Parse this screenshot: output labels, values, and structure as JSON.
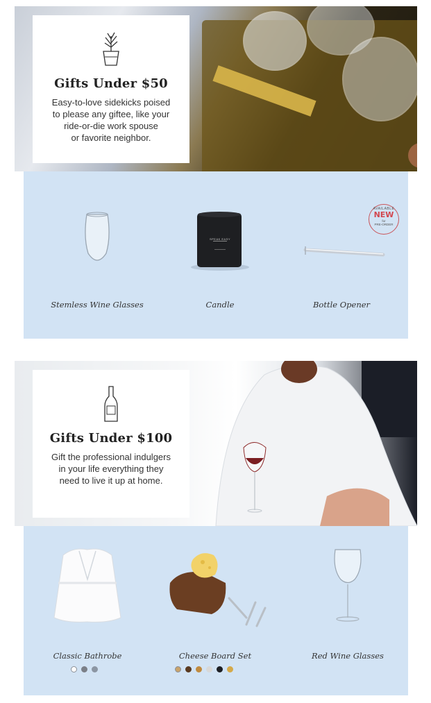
{
  "sections": [
    {
      "title": "Gifts Under $50",
      "description": "Easy-to-love sidekicks poised\nto please any giftee, like your\nride-or-die work spouse\nor favorite neighbor.",
      "icon": "plant-icon",
      "products": [
        {
          "label": "Stemless Wine Glasses"
        },
        {
          "label": "Candle",
          "product_text": "SPEAK EASY"
        },
        {
          "label": "Bottle Opener",
          "badge": {
            "top": "AVAILABLE",
            "main": "NEW",
            "middle": "for",
            "bottom": "PRE-ORDER"
          }
        }
      ]
    },
    {
      "title": "Gifts Under $100",
      "description": "Gift the professional indulgers\nin your life everything they\nneed to live it up at home.",
      "icon": "wine-bottle-icon",
      "products": [
        {
          "label": "Classic Bathrobe",
          "swatches": [
            "#ffffff",
            "#7b7f87",
            "#8c96a3"
          ]
        },
        {
          "label": "Cheese Board Set",
          "swatches": [
            "#c9a36b",
            "#5a3a20",
            "#c08a3e",
            "#d8d8d8",
            "#1d1f24",
            "#d4a94a"
          ]
        },
        {
          "label": "Red Wine Glasses"
        }
      ]
    }
  ]
}
